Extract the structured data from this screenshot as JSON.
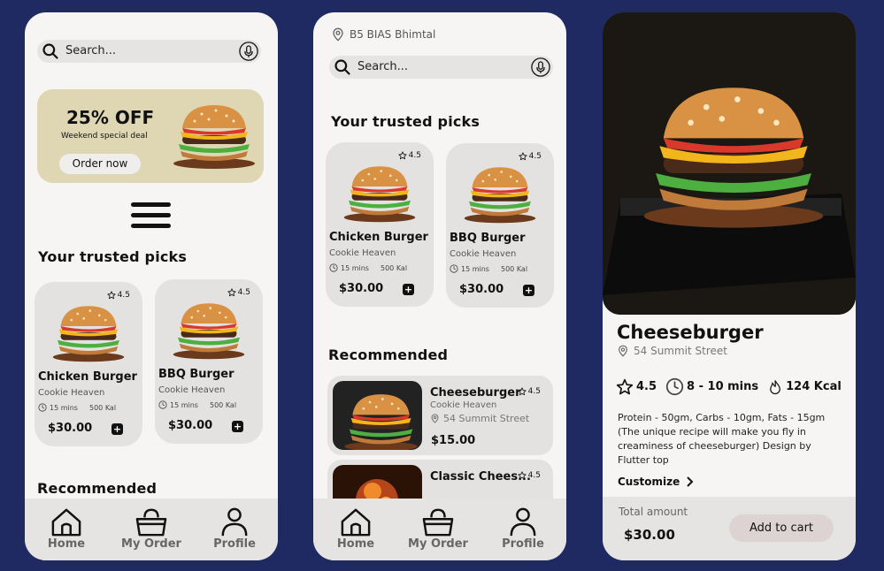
{
  "screen1": {
    "search_placeholder": "Search...",
    "promo": {
      "title": "25% OFF",
      "subtitle": "Weekend special deal",
      "button": "Order now"
    },
    "trusted_title": "Your trusted picks",
    "cards": [
      {
        "rating": "4.5",
        "name": "Chicken Burger",
        "shop": "Cookie Heaven",
        "time": "15 mins",
        "kcal": "500 Kal",
        "price": "$30.00"
      },
      {
        "rating": "4.5",
        "name": "BBQ Burger",
        "shop": "Cookie Heaven",
        "time": "15 mins",
        "kcal": "500 Kal",
        "price": "$30.00"
      }
    ],
    "recommended_title": "Recommended"
  },
  "screen2": {
    "location": "B5 BIAS Bhimtal",
    "search_placeholder": "Search...",
    "trusted_title": "Your trusted picks",
    "cards": [
      {
        "rating": "4.5",
        "name": "Chicken Burger",
        "shop": "Cookie Heaven",
        "time": "15 mins",
        "kcal": "500 Kal",
        "price": "$30.00"
      },
      {
        "rating": "4.5",
        "name": "BBQ Burger",
        "shop": "Cookie Heaven",
        "time": "15 mins",
        "kcal": "500 Kal",
        "price": "$30.00"
      }
    ],
    "recommended_title": "Recommended",
    "recommended": [
      {
        "name": "Cheeseburger",
        "shop": "Cookie Heaven",
        "address": "54 Summit Street",
        "price": "$15.00",
        "rating": "4.5"
      },
      {
        "name": "Classic Chees...",
        "rating": "4.5"
      }
    ]
  },
  "nav": {
    "home": "Home",
    "orders": "My Order",
    "profile": "Profile"
  },
  "screen3": {
    "title": "Cheeseburger",
    "address": "54 Summit Street",
    "rating": "4.5",
    "time": "8 - 10 mins",
    "kcal": "124 Kcal",
    "description": "Protein - 50gm, Carbs - 10gm, Fats - 15gm (The unique recipe will make you fly in creaminess of cheeseburger) Design by Flutter top",
    "customize": "Customize",
    "total_label": "Total amount",
    "total": "$30.00",
    "cart_button": "Add to cart"
  }
}
